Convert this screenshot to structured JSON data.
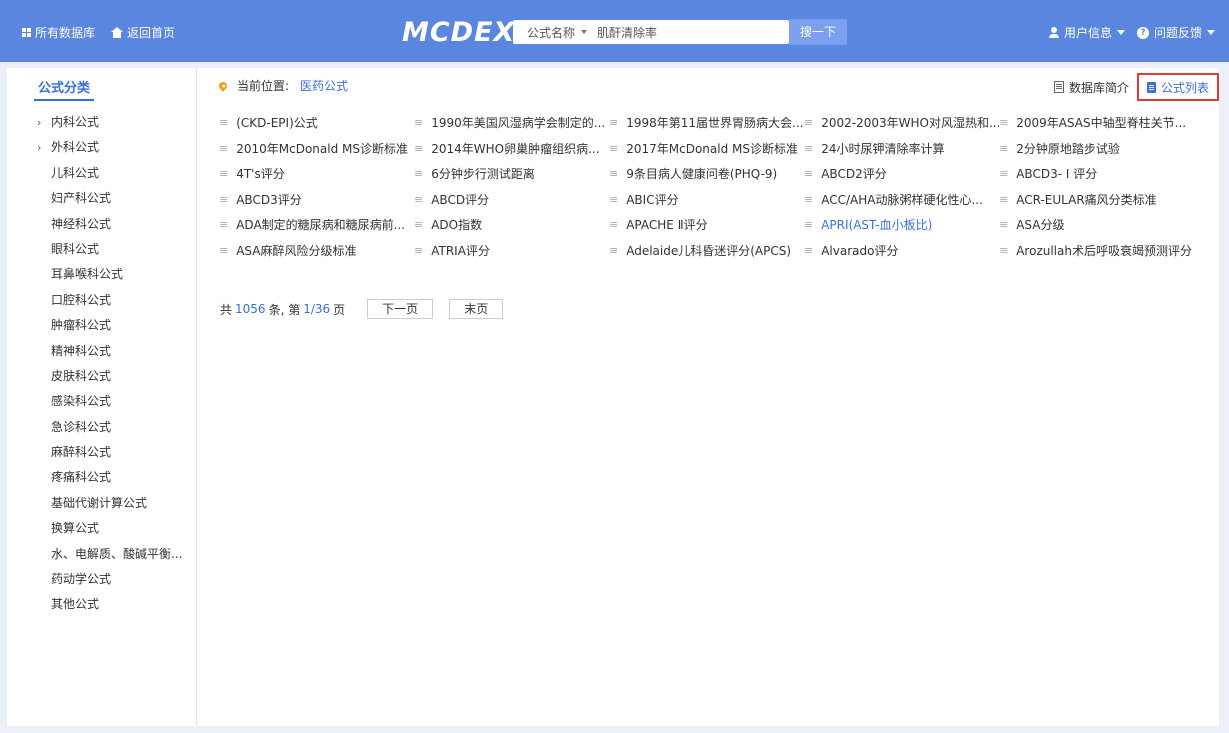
{
  "topbar": {
    "all_db": "所有数据库",
    "home": "返回首页",
    "logo": "MCDEX",
    "search_type": "公式名称",
    "search_value": "肌酐清除率",
    "search_btn": "搜一下",
    "user_info": "用户信息",
    "feedback": "问题反馈"
  },
  "sidebar": {
    "title": "公式分类",
    "items": [
      {
        "label": "内科公式",
        "expandable": true
      },
      {
        "label": "外科公式",
        "expandable": true
      },
      {
        "label": "儿科公式",
        "expandable": false
      },
      {
        "label": "妇产科公式",
        "expandable": false
      },
      {
        "label": "神经科公式",
        "expandable": false
      },
      {
        "label": "眼科公式",
        "expandable": false
      },
      {
        "label": "耳鼻喉科公式",
        "expandable": false
      },
      {
        "label": "口腔科公式",
        "expandable": false
      },
      {
        "label": "肿瘤科公式",
        "expandable": false
      },
      {
        "label": "精神科公式",
        "expandable": false
      },
      {
        "label": "皮肤科公式",
        "expandable": false
      },
      {
        "label": "感染科公式",
        "expandable": false
      },
      {
        "label": "急诊科公式",
        "expandable": false
      },
      {
        "label": "麻醉科公式",
        "expandable": false
      },
      {
        "label": "疼痛科公式",
        "expandable": false
      },
      {
        "label": "基础代谢计算公式",
        "expandable": false
      },
      {
        "label": "换算公式",
        "expandable": false
      },
      {
        "label": "水、电解质、酸碱平衡...",
        "expandable": false
      },
      {
        "label": "药动学公式",
        "expandable": false
      },
      {
        "label": "其他公式",
        "expandable": false
      }
    ]
  },
  "breadcrumb": {
    "label": "当前位置:",
    "current": "医药公式"
  },
  "view_tabs": {
    "intro": "数据库简介",
    "list": "公式列表"
  },
  "formulas": [
    {
      "label": "(CKD-EPI)公式",
      "hl": false
    },
    {
      "label": "1990年美国风湿病学会制定的...",
      "hl": false
    },
    {
      "label": "1998年第11届世界胃肠病大会...",
      "hl": false
    },
    {
      "label": "2002-2003年WHO对风湿热和...",
      "hl": false
    },
    {
      "label": "2009年ASAS中轴型脊柱关节...",
      "hl": false
    },
    {
      "label": "2010年McDonald MS诊断标准",
      "hl": false
    },
    {
      "label": "2014年WHO卵巢肿瘤组织病...",
      "hl": false
    },
    {
      "label": "2017年McDonald MS诊断标准",
      "hl": false
    },
    {
      "label": "24小时尿钾清除率计算",
      "hl": false
    },
    {
      "label": "2分钟原地踏步试验",
      "hl": false
    },
    {
      "label": "4T's评分",
      "hl": false
    },
    {
      "label": "6分钟步行测试距离",
      "hl": false
    },
    {
      "label": "9条目病人健康问卷(PHQ-9)",
      "hl": false
    },
    {
      "label": "ABCD2评分",
      "hl": false
    },
    {
      "label": "ABCD3- I 评分",
      "hl": false
    },
    {
      "label": "ABCD3评分",
      "hl": false
    },
    {
      "label": "ABCD评分",
      "hl": false
    },
    {
      "label": "ABIC评分",
      "hl": false
    },
    {
      "label": "ACC/AHA动脉粥样硬化性心...",
      "hl": false
    },
    {
      "label": "ACR-EULAR痛风分类标准",
      "hl": false
    },
    {
      "label": "ADA制定的糖尿病和糖尿病前...",
      "hl": false
    },
    {
      "label": "ADO指数",
      "hl": false
    },
    {
      "label": "APACHE Ⅱ评分",
      "hl": false
    },
    {
      "label": "APRI(AST-血小板比)",
      "hl": true
    },
    {
      "label": "ASA分级",
      "hl": false
    },
    {
      "label": "ASA麻醉风险分级标准",
      "hl": false
    },
    {
      "label": "ATRIA评分",
      "hl": false
    },
    {
      "label": "Adelaide儿科昏迷评分(APCS)",
      "hl": false
    },
    {
      "label": "Alvarado评分",
      "hl": false
    },
    {
      "label": "Arozullah术后呼吸衰竭预测评分",
      "hl": false
    }
  ],
  "pager": {
    "prefix": "共",
    "total": "1056",
    "mid": "条, 第",
    "page": "1/36",
    "suffix": "页",
    "next": "下一页",
    "last": "末页"
  },
  "colors": {
    "topbar": "#5b86e0",
    "accent": "#3a6fd8",
    "highlight_border": "#e53935"
  }
}
